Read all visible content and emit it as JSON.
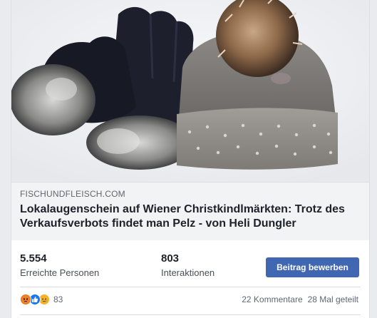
{
  "post": {
    "link": {
      "domain": "FISCHUNDFLEISCH.COM",
      "title": "Lokalaugenschein auf Wiener Christkindlmärkten: Trotz des Verkaufsverbots findet man Pelz - von Heli Dungler",
      "image_alt": "knitted grey beanie with fur pompom and black gloves with fur cuffs"
    },
    "insights": {
      "reach": {
        "value": "5.554",
        "label": "Erreichte Personen"
      },
      "engagement": {
        "value": "803",
        "label": "Interaktionen"
      },
      "boost_label": "Beitrag bewerben"
    },
    "footer": {
      "reaction_icons": [
        "angry-icon",
        "like-icon",
        "sad-icon"
      ],
      "reaction_count": "83",
      "comments": "22 Kommentare",
      "shares": "28 Mal geteilt"
    }
  },
  "colors": {
    "button_blue": "#4267b2",
    "link_meta_bg": "#f2f3f5",
    "page_bg": "#e9ebee",
    "like_blue": "#1877f2",
    "angry_orange": "#e9710f",
    "sad_yellow": "#f7b125"
  }
}
